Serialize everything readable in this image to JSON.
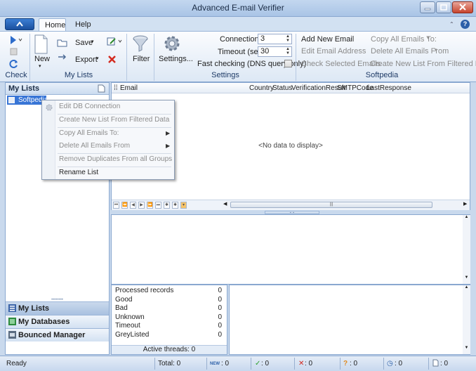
{
  "window": {
    "title": "Advanced E-mail Verifier"
  },
  "tabs": [
    {
      "label": "Home"
    },
    {
      "label": "Help"
    }
  ],
  "ribbon": {
    "check_group": {
      "label": "Check"
    },
    "lists_group": {
      "label": "My Lists",
      "new": "New",
      "save": "Save",
      "export": "Export"
    },
    "filter": {
      "label": "Filter"
    },
    "settings_button": {
      "label": "Settings..."
    },
    "settings_group": {
      "label": "Settings",
      "connections_label": "Connections:",
      "connections_value": "3",
      "timeout_label": "Timeout (sec):",
      "timeout_value": "30",
      "fast_checking_label": "Fast checking (DNS query only)",
      "fast_checking_checked": false
    },
    "softpedia_group": {
      "label": "Softpedia",
      "add_new_email": "Add New Email",
      "edit_email_address": "Edit Email Address",
      "check_selected_emails": "Check Selected Emails",
      "copy_all_emails_to": "Copy All Emails To:",
      "delete_all_emails_from": "Delete All Emails From",
      "create_new_list": "Create New List From Filtered Data"
    }
  },
  "left_panel": {
    "header": "My Lists",
    "items": [
      {
        "label": "Softpedia"
      }
    ],
    "nav": [
      {
        "label": "My Lists"
      },
      {
        "label": "My Databases"
      },
      {
        "label": "Bounced Manager"
      }
    ]
  },
  "grid": {
    "columns": [
      "Email",
      "Country",
      "Status",
      "VerificationResult",
      "SMTPCode",
      "LastResponse"
    ],
    "empty_text": "<No data to display>"
  },
  "stats": {
    "rows": [
      {
        "label": "Processed records",
        "value": "0"
      },
      {
        "label": "Good",
        "value": "0"
      },
      {
        "label": "Bad",
        "value": "0"
      },
      {
        "label": "Unknown",
        "value": "0"
      },
      {
        "label": "Timeout",
        "value": "0"
      },
      {
        "label": "GreyListed",
        "value": "0"
      }
    ],
    "active_threads": "Active threads: 0"
  },
  "context_menu": {
    "items": [
      {
        "label": "Edit DB Connection",
        "enabled": false
      },
      {
        "label": "Create New List From Filtered Data",
        "enabled": false
      },
      {
        "label": "Copy All Emails To:",
        "enabled": false
      },
      {
        "label": "Delete All Emails From",
        "enabled": false
      },
      {
        "label": "Remove Duplicates From all Groups",
        "enabled": false
      },
      {
        "label": "Rename List",
        "enabled": true
      }
    ]
  },
  "status_bar": {
    "ready": "Ready",
    "total": "Total: 0",
    "new_badge": "NEW",
    "new_count": ": 0",
    "good_count": ": 0",
    "bad_count": ": 0",
    "unknown_count": ": 0",
    "timeout_count": ": 0",
    "greylisted_count": ": 0"
  },
  "colors": {
    "accent": "#3875d6",
    "ribbon_blue": "#1e3a66",
    "good": "#2ea12e",
    "bad": "#d42a1f",
    "unknown": "#e08a1e"
  }
}
